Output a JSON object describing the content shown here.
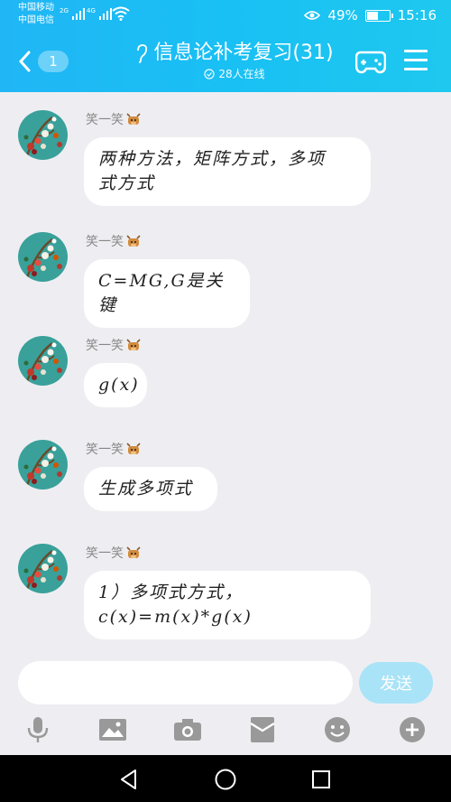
{
  "status_bar": {
    "carrier1": "中国移动",
    "carrier2": "中国电信",
    "net1": "2G",
    "net2": "4G",
    "battery": "49%",
    "battery_level": 0.49,
    "time": "15:16"
  },
  "header": {
    "unread_count": "1",
    "title": "信息论补考复习(31)",
    "online": "28人在线",
    "icons": [
      "back-chevron-icon",
      "ear-icon",
      "gamepad-icon",
      "menu-icon",
      "online-check-icon"
    ]
  },
  "messages": [
    {
      "sender": "笑一笑",
      "lines": [
        "两种方法，矩阵方式，多项",
        "式方式"
      ]
    },
    {
      "sender": "笑一笑",
      "lines": [
        "C=MG,G是关键"
      ]
    },
    {
      "sender": "笑一笑",
      "lines": [
        "g(x)"
      ]
    },
    {
      "sender": "笑一笑",
      "lines": [
        "生成多项式"
      ]
    },
    {
      "sender": "笑一笑",
      "lines": [
        "1）多项式方式，",
        "c(x)=m(x)*g(x)"
      ]
    }
  ],
  "input": {
    "value": "",
    "placeholder": "",
    "send_label": "发送"
  },
  "toolbar": [
    "microphone-icon",
    "image-icon",
    "camera-icon",
    "red-packet-icon",
    "emoji-icon",
    "plus-icon"
  ],
  "navbar": [
    "back-triangle-icon",
    "home-circle-icon",
    "recents-square-icon"
  ],
  "colors": {
    "header_start": "#20b6f5",
    "header_end": "#1ec8ee",
    "send": "#a9e3f7",
    "background": "#eeeef2"
  }
}
